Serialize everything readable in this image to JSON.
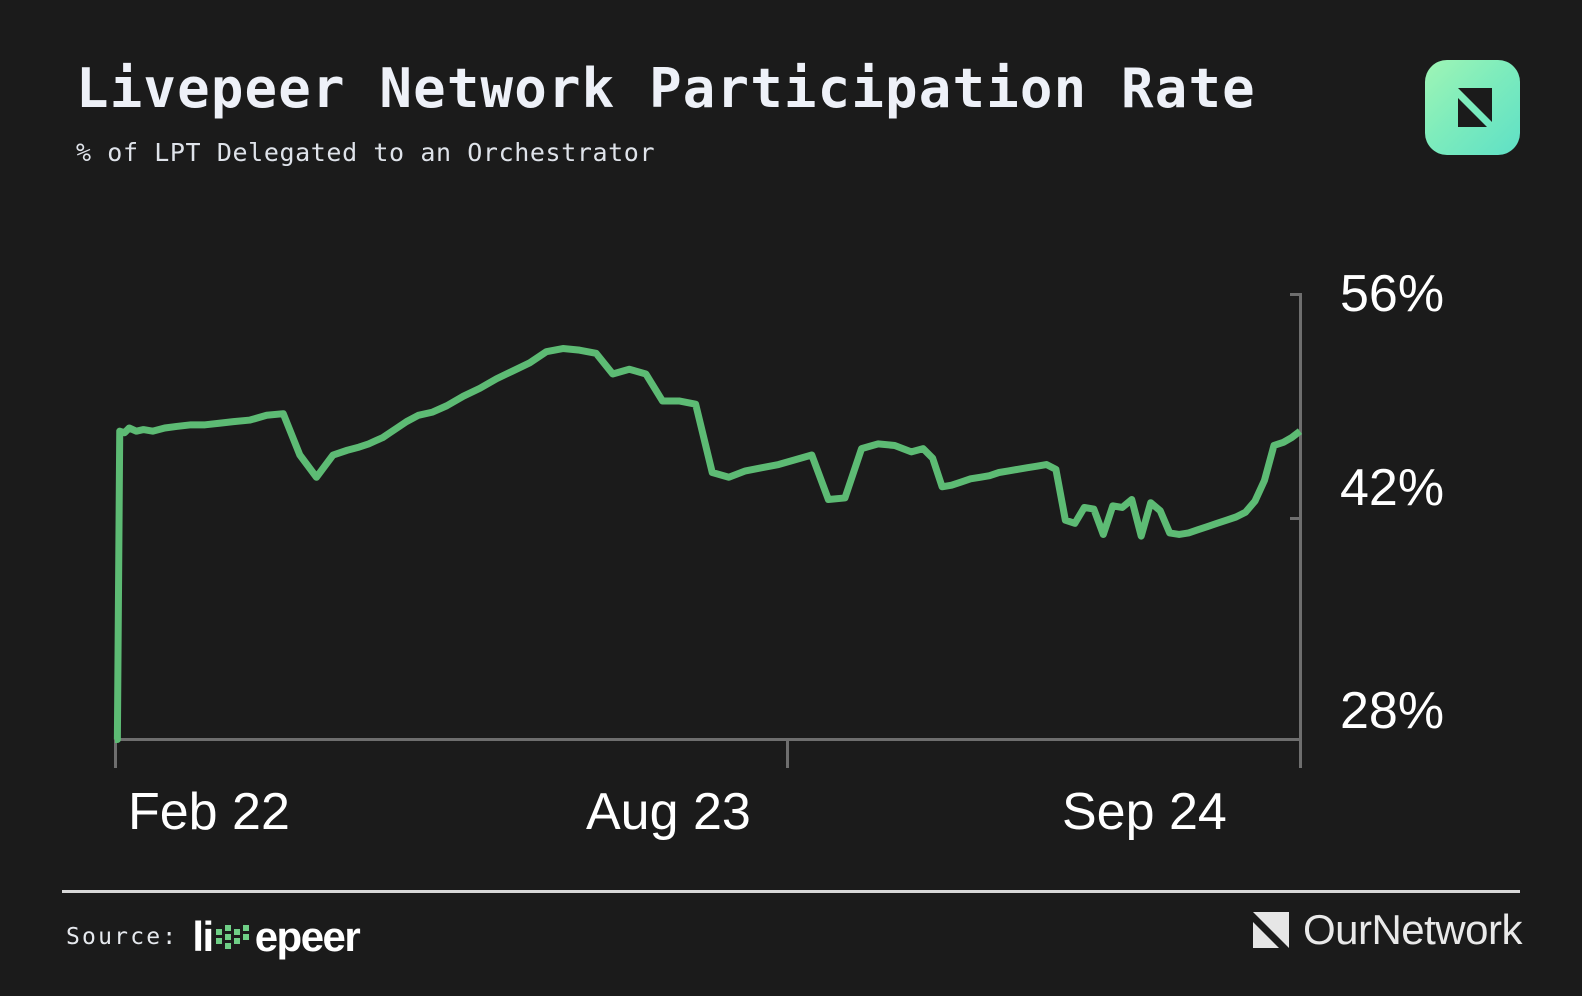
{
  "header": {
    "title": "Livepeer Network Participation Rate",
    "subtitle": "% of LPT Delegated to an Orchestrator",
    "brand_icon": "ournetwork-mark-icon"
  },
  "footer": {
    "source_label": "Source:",
    "source_name": "livepeer",
    "source_name_prefix": "li",
    "source_name_suffix": "epeer",
    "attribution": "OurNetwork",
    "attribution_icon": "ournetwork-mark-icon"
  },
  "colors": {
    "background": "#1b1b1b",
    "line": "#5dbb74",
    "axis": "#6e6e6e",
    "tick_text": "#ffffff",
    "title_text": "#eef1f8",
    "divider": "#d8d8d8",
    "brand_gradient_start": "#9ff5b5",
    "brand_gradient_end": "#5fe0c6",
    "livepeer_dot": "#6fcf86"
  },
  "chart_data": {
    "type": "line",
    "title": "Livepeer Network Participation Rate",
    "subtitle": "% of LPT Delegated to an Orchestrator",
    "xlabel": "",
    "ylabel": "% of LPT Delegated to an Orchestrator",
    "ylim": [
      28,
      56
    ],
    "yticks": [
      28,
      42,
      56
    ],
    "ytick_labels": [
      "28%",
      "42%",
      "56%"
    ],
    "xticks": [
      "Feb 22",
      "Aug 23",
      "Sep 24"
    ],
    "xtick_labels": [
      "Feb 22",
      "Aug 23",
      "Sep 24"
    ],
    "grid": false,
    "legend": false,
    "series": [
      {
        "name": "Participation Rate",
        "color": "#5dbb74",
        "x": [
          0.0,
          0.2,
          0.4,
          0.8,
          1.2,
          1.8,
          2.4,
          3.2,
          4.2,
          5.2,
          6.4,
          7.6,
          8.8,
          10.0,
          11.4,
          12.8,
          14.2,
          15.6,
          17.0,
          18.4,
          19.6,
          20.6,
          21.4,
          22.0,
          22.6,
          23.2,
          23.8,
          24.6,
          25.6,
          26.8,
          28.0,
          29.4,
          30.8,
          32.2,
          33.6,
          35.0,
          36.4,
          37.8,
          39.2,
          40.6,
          42.0,
          43.4,
          44.8,
          46.2,
          47.6,
          49.0,
          50.4,
          51.8,
          53.2,
          54.6,
          56.0,
          57.4,
          58.8,
          60.2,
          61.6,
          63.0,
          64.4,
          65.8,
          67.2,
          68.2,
          69.0,
          69.8,
          70.6,
          71.4,
          72.2,
          73.0,
          73.8,
          74.6,
          75.4,
          76.2,
          77.0,
          77.8,
          78.6,
          79.4,
          80.2,
          81.0,
          81.8,
          82.6,
          83.4,
          84.2,
          85.0,
          85.8,
          86.6,
          87.4,
          88.2,
          89.0,
          89.8,
          90.6,
          91.4,
          92.2,
          93.0,
          93.8,
          94.6,
          95.4,
          96.2,
          97.0,
          97.8,
          98.6,
          99.3,
          100.0
        ],
        "y": [
          28.0,
          28.0,
          47.4,
          47.3,
          47.6,
          47.4,
          47.5,
          47.4,
          47.6,
          47.7,
          47.8,
          47.8,
          47.9,
          48.0,
          48.1,
          48.4,
          48.5,
          45.9,
          44.5,
          45.9,
          46.2,
          46.4,
          46.6,
          46.8,
          47.0,
          47.3,
          47.6,
          48.0,
          48.4,
          48.6,
          49.0,
          49.6,
          50.1,
          50.7,
          51.2,
          51.7,
          52.4,
          52.6,
          52.5,
          52.3,
          51.0,
          51.3,
          51.0,
          49.3,
          49.3,
          49.1,
          44.8,
          44.5,
          44.9,
          45.1,
          45.3,
          45.6,
          45.9,
          43.1,
          43.2,
          46.3,
          46.6,
          46.5,
          46.1,
          46.3,
          45.7,
          43.9,
          44.0,
          44.2,
          44.4,
          44.5,
          44.6,
          44.8,
          44.9,
          45.0,
          45.1,
          45.2,
          45.3,
          45.0,
          41.8,
          41.6,
          42.6,
          42.5,
          40.9,
          42.7,
          42.6,
          43.1,
          40.8,
          42.9,
          42.4,
          41.0,
          40.9,
          41.0,
          41.2,
          41.4,
          41.6,
          41.8,
          42.0,
          42.3,
          43.0,
          44.3,
          46.5,
          46.7,
          47.0,
          47.4
        ]
      }
    ]
  }
}
